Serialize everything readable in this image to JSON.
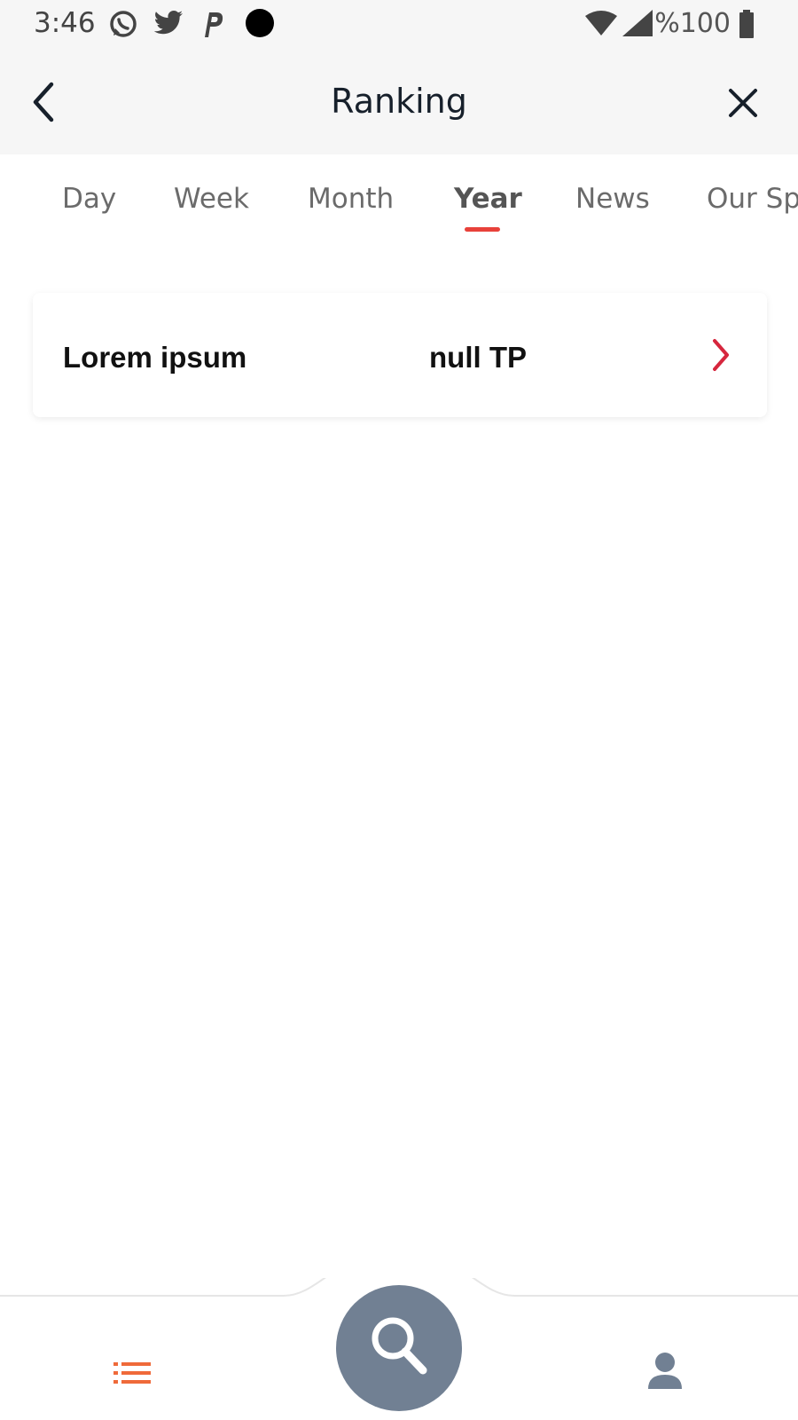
{
  "status_bar": {
    "time": "3:46",
    "battery": "%100",
    "icons": [
      "whatsapp-icon",
      "twitter-icon",
      "parking-icon",
      "dot-icon",
      "wifi-icon",
      "signal-icon",
      "battery-icon"
    ]
  },
  "header": {
    "title": "Ranking",
    "back_icon": "chevron-left-icon",
    "close_icon": "close-icon"
  },
  "tabs": {
    "items": [
      {
        "label": "Day"
      },
      {
        "label": "Week"
      },
      {
        "label": "Month"
      },
      {
        "label": "Year"
      },
      {
        "label": "News"
      },
      {
        "label": "Our Sp"
      }
    ],
    "active_index": 3,
    "active_color": "#e8413a"
  },
  "ranking": {
    "entries": [
      {
        "name": "Lorem ipsum",
        "points": "null TP"
      }
    ],
    "chevron_color": "#d6263d"
  },
  "bottom_nav": {
    "list_icon": "list-icon",
    "search_icon": "search-icon",
    "profile_icon": "profile-icon",
    "list_color": "#ef6a3a",
    "fab_color": "#718093",
    "profile_color": "#718093"
  }
}
